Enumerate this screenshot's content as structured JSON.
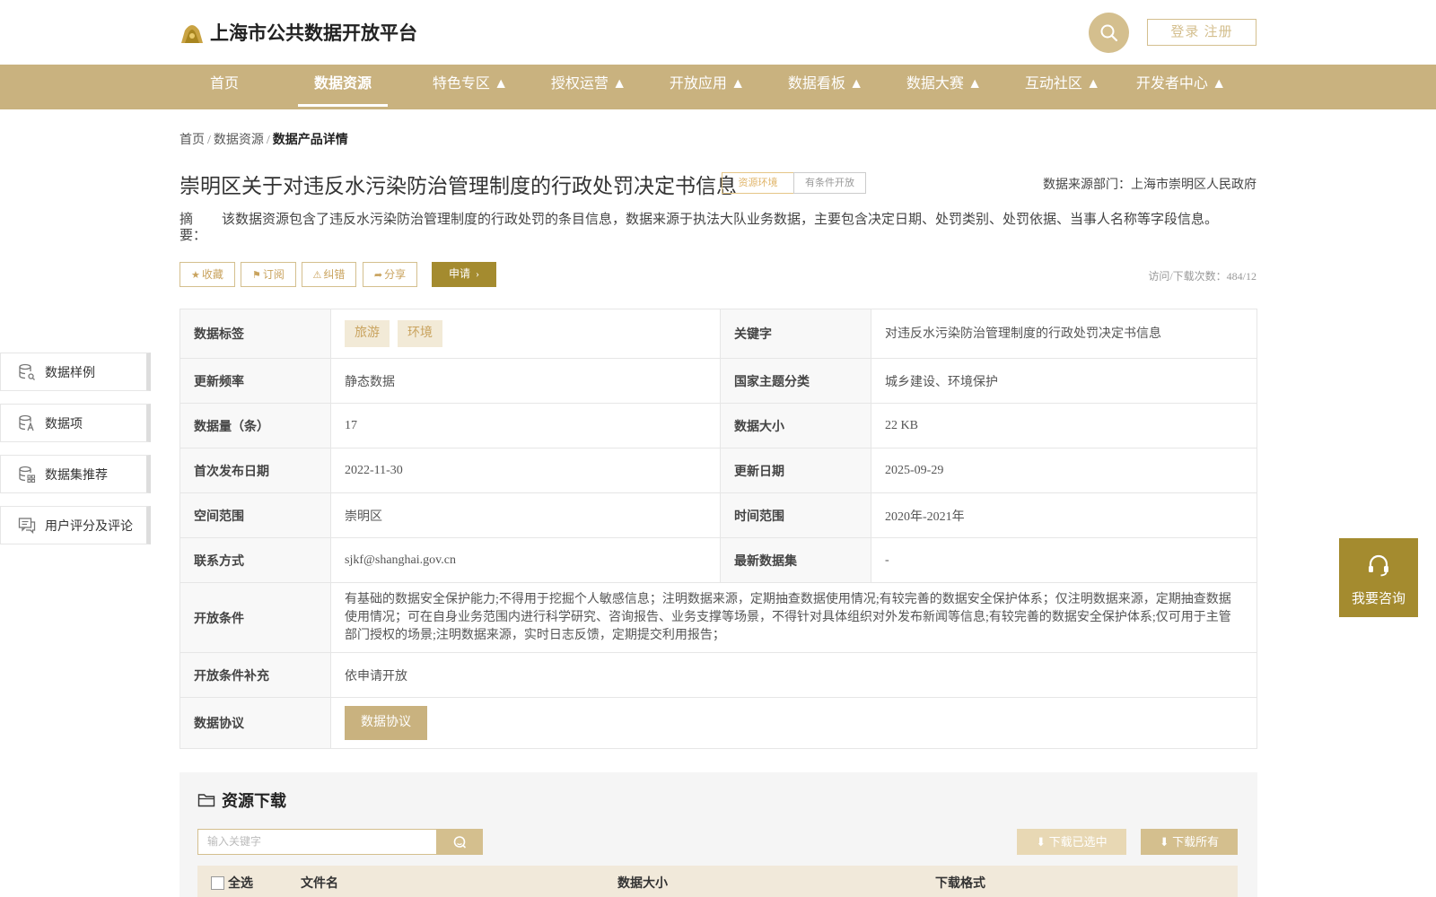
{
  "header": {
    "title": "上海市公共数据开放平台",
    "login": "登录 注册"
  },
  "nav": {
    "items": [
      "首页",
      "数据资源",
      "特色专区 ▲",
      "授权运营 ▲",
      "开放应用 ▲",
      "数据看板 ▲",
      "数据大赛 ▲",
      "互动社区 ▲",
      "开发者中心 ▲"
    ],
    "active": "数据资源"
  },
  "breadcrumb": {
    "home": "首页",
    "sep": "/",
    "section": "数据资源",
    "current": "数据产品详情"
  },
  "dataset": {
    "title": "崇明区关于对违反水污染防治管理制度的行政处罚决定书信息",
    "tag_theme": "资源环境",
    "tag_open": "有条件开放",
    "source_dept": "数据来源部门：上海市崇明区人民政府",
    "abstract_label": "摘 要：",
    "abstract": "该数据资源包含了违反水污染防治管理制度的行政处罚的条目信息，数据来源于执法大队业务数据，主要包含决定日期、处罚类别、处罚依据、当事人名称等字段信息。"
  },
  "actions": {
    "favorite": "收藏",
    "subscribe": "订阅",
    "correct": "纠错",
    "share": "分享",
    "apply": "申请",
    "visit_count": "访问/下载次数：484/12"
  },
  "side_menu": {
    "items": [
      "数据样例",
      "数据项",
      "数据集推荐",
      "用户评分及评论"
    ]
  },
  "info": {
    "tags_label": "数据标签",
    "tags": [
      "旅游",
      "环境"
    ],
    "keyword_label": "关键字",
    "keyword": "对违反水污染防治管理制度的行政处罚决定书信息",
    "freq_label": "更新频率",
    "freq": "静态数据",
    "theme_label": "国家主题分类",
    "theme": "城乡建设、环境保护",
    "count_label": "数据量（条）",
    "count": "17",
    "size_label": "数据大小",
    "size": "22 KB",
    "first_date_label": "首次发布日期",
    "first_date": "2022-11-30",
    "update_date_label": "更新日期",
    "update_date": "2025-09-29",
    "space_label": "空间范围",
    "space": "崇明区",
    "time_label": "时间范围",
    "time": "2020年-2021年",
    "contact_label": "联系方式",
    "contact": "sjkf@shanghai.gov.cn",
    "latest_label": "最新数据集",
    "latest": "-",
    "condition_label": "开放条件",
    "condition": "有基础的数据安全保护能力;不得用于挖掘个人敏感信息；注明数据来源，定期抽查数据使用情况;有较完善的数据安全保护体系；仅注明数据来源，定期抽查数据使用情况；可在自身业务范围内进行科学研究、咨询报告、业务支撑等场景，不得针对具体组织对外发布新闻等信息;有较完善的数据安全保护体系;仅可用于主管部门授权的场景;注明数据来源，实时日志反馈，定期提交利用报告；",
    "condition_extra_label": "开放条件补充",
    "condition_extra": "依申请开放",
    "protocol_label": "数据协议",
    "protocol_btn": "数据协议"
  },
  "download": {
    "title": "资源下载",
    "placeholder": "输入关键字",
    "download_selected": "下载已选中",
    "download_all": "下载所有",
    "columns": {
      "select_all": "全选",
      "file_name": "文件名",
      "size": "数据大小",
      "format": "下载格式"
    }
  },
  "consult": {
    "label": "我要咨询"
  },
  "colors": {
    "brand": "#c9b27f",
    "accent_dark": "#a48b2f",
    "tag_gold": "#e0b56a"
  }
}
